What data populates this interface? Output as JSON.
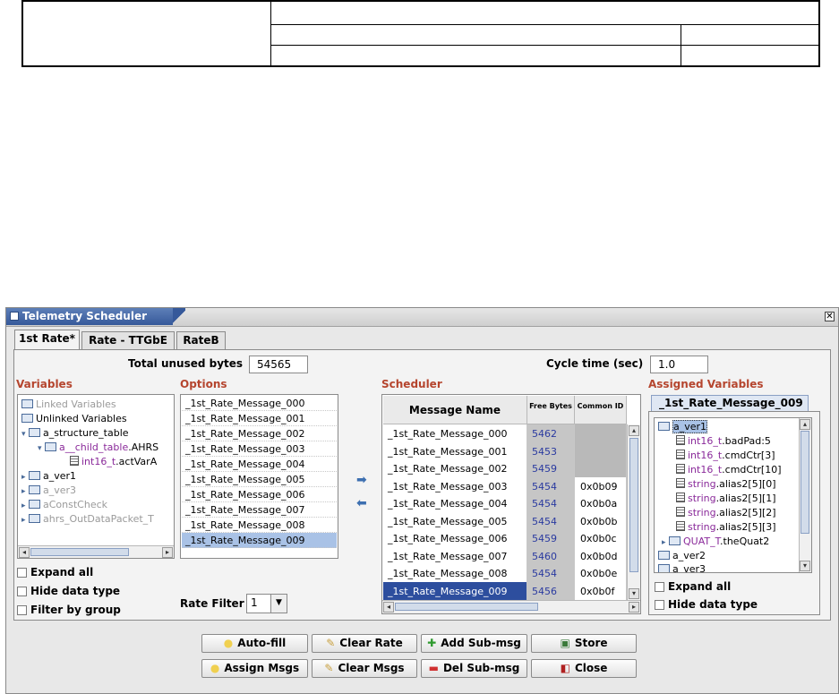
{
  "window": {
    "title": "Telemetry Scheduler",
    "close_glyph": "✕"
  },
  "tabs": [
    "1st Rate*",
    "Rate - TTGbE",
    "RateB"
  ],
  "unused": {
    "label": "Total unused bytes",
    "value": "54565"
  },
  "cycle": {
    "label": "Cycle time (sec)",
    "value": "1.0"
  },
  "variables": {
    "header": "Variables",
    "items": [
      "Linked Variables",
      "Unlinked Variables",
      "a_structure_table",
      "a__child_table",
      ".AHRS",
      "int16_t",
      ".actVarA",
      "a_ver1",
      "a_ver3",
      "aConstCheck",
      "ahrs_OutDataPacket_T"
    ],
    "expand_all": "Expand all",
    "hide_data_type": "Hide data type",
    "filter_by_group": "Filter by group"
  },
  "options": {
    "header": "Options",
    "items": [
      "_1st_Rate_Message_000",
      "_1st_Rate_Message_001",
      "_1st_Rate_Message_002",
      "_1st_Rate_Message_003",
      "_1st_Rate_Message_004",
      "_1st_Rate_Message_005",
      "_1st_Rate_Message_006",
      "_1st_Rate_Message_007",
      "_1st_Rate_Message_008",
      "_1st_Rate_Message_009"
    ],
    "selected_index": 9,
    "rate_filter_label": "Rate Filter",
    "rate_filter_value": "1"
  },
  "scheduler": {
    "header": "Scheduler",
    "columns": [
      "Message Name",
      "Free Bytes",
      "Common ID"
    ],
    "rows": [
      {
        "name": "_1st_Rate_Message_000",
        "free": "5462",
        "id": ""
      },
      {
        "name": "_1st_Rate_Message_001",
        "free": "5453",
        "id": ""
      },
      {
        "name": "_1st_Rate_Message_002",
        "free": "5459",
        "id": ""
      },
      {
        "name": "_1st_Rate_Message_003",
        "free": "5454",
        "id": "0x0b09"
      },
      {
        "name": "_1st_Rate_Message_004",
        "free": "5454",
        "id": "0x0b0a"
      },
      {
        "name": "_1st_Rate_Message_005",
        "free": "5454",
        "id": "0x0b0b"
      },
      {
        "name": "_1st_Rate_Message_006",
        "free": "5459",
        "id": "0x0b0c"
      },
      {
        "name": "_1st_Rate_Message_007",
        "free": "5460",
        "id": "0x0b0d"
      },
      {
        "name": "_1st_Rate_Message_008",
        "free": "5454",
        "id": "0x0b0e"
      },
      {
        "name": "_1st_Rate_Message_009",
        "free": "5456",
        "id": "0x0b0f"
      }
    ],
    "selected_index": 9
  },
  "assigned": {
    "header": "Assigned Variables",
    "tab": "_1st_Rate_Message_009",
    "items": [
      "a_ver1",
      "int16_t",
      ".badPad:5",
      "int16_t",
      ".cmdCtr[3]",
      "int16_t",
      ".cmdCtr[10]",
      "string",
      ".alias2[5][0]",
      "string",
      ".alias2[5][1]",
      "string",
      ".alias2[5][2]",
      "string",
      ".alias2[5][3]",
      "QUAT_T",
      ".theQuat2",
      "a_ver2",
      "a_ver3"
    ],
    "expand_all": "Expand all",
    "hide_data_type": "Hide data type"
  },
  "buttons": {
    "auto_fill": "Auto-fill",
    "clear_rate": "Clear Rate",
    "add_sub_msg": "Add Sub-msg",
    "store": "Store",
    "assign_msgs": "Assign Msgs",
    "clear_msgs": "Clear Msgs",
    "del_sub_msg": "Del Sub-msg",
    "close": "Close"
  }
}
